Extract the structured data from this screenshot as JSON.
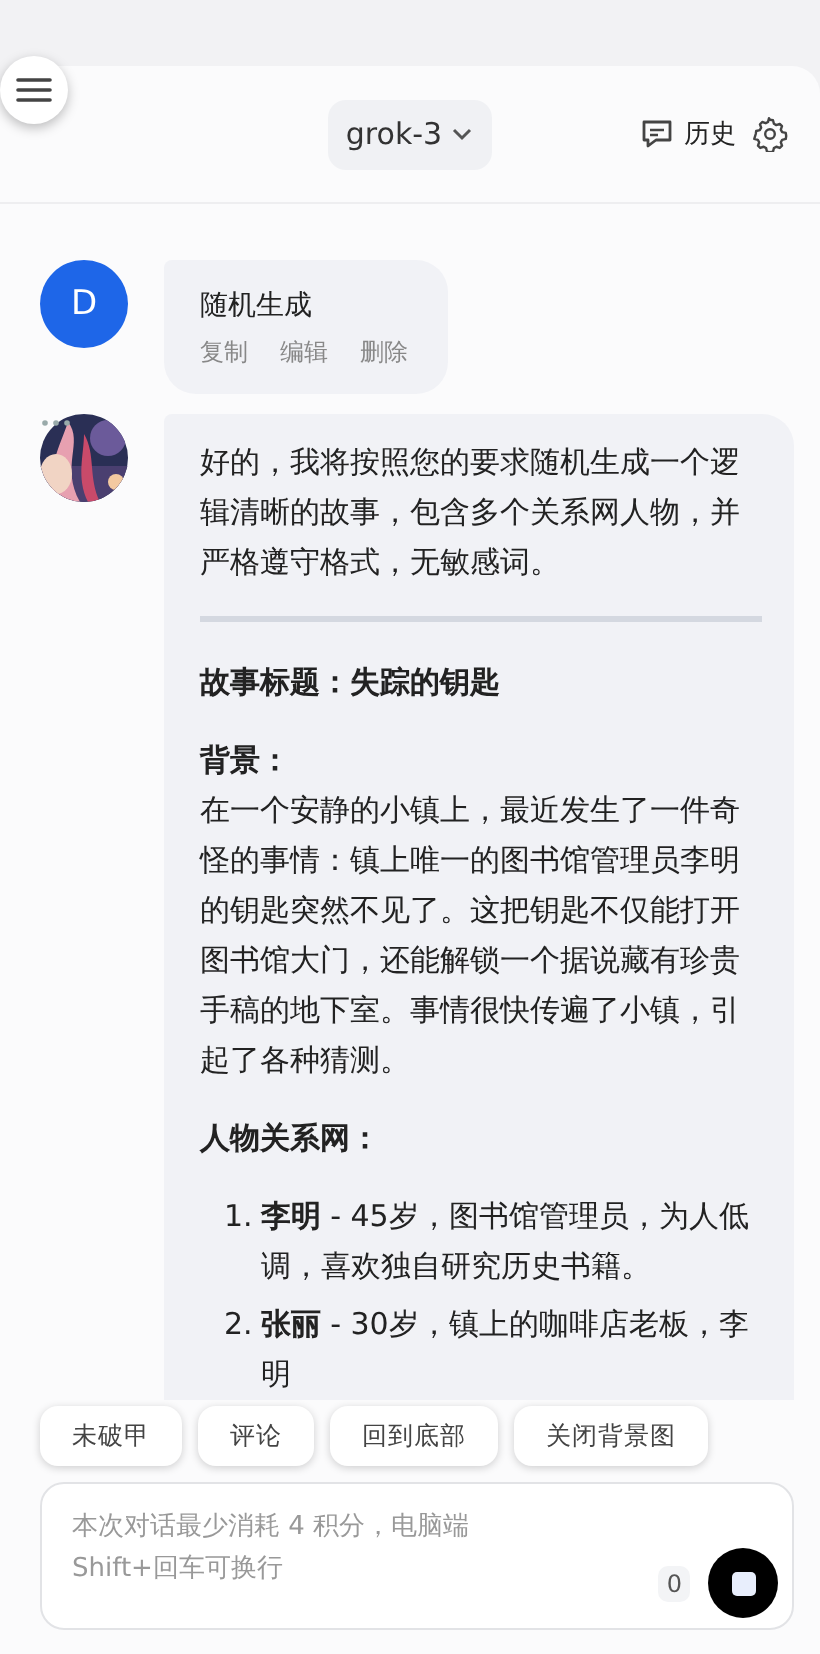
{
  "header": {
    "model": "grok-3",
    "history": "历史"
  },
  "user_message": {
    "avatar": "D",
    "text": "随机生成",
    "actions": [
      "复制",
      "编辑",
      "删除"
    ]
  },
  "assistant_message": {
    "intro": "好的，我将按照您的要求随机生成一个逻辑清晰的故事，包含多个关系网人物，并严格遵守格式，无敏感词。",
    "title": "故事标题：失踪的钥匙",
    "background_heading": "背景：",
    "background": "在一个安静的小镇上，最近发生了一件奇怪的事情：镇上唯一的图书馆管理员李明的钥匙突然不见了。这把钥匙不仅能打开图书馆大门，还能解锁一个据说藏有珍贵手稿的地下室。事情很快传遍了小镇，引起了各种猜测。",
    "people_heading": "人物关系网：",
    "people": [
      {
        "number": "1.",
        "text": "**李明** - 45岁，图书馆管理员，为人低调，喜欢独自研究历史书籍。"
      },
      {
        "number": "2.",
        "text": "**张丽** - 30岁，镇上的咖啡店老板，李明"
      }
    ]
  },
  "quick_buttons": [
    "未破甲",
    "评论",
    "回到底部",
    "关闭背景图"
  ],
  "input": {
    "placeholder": "本次对话最少消耗 4 积分，电脑端\nShift+回车可换行",
    "count": "0"
  }
}
